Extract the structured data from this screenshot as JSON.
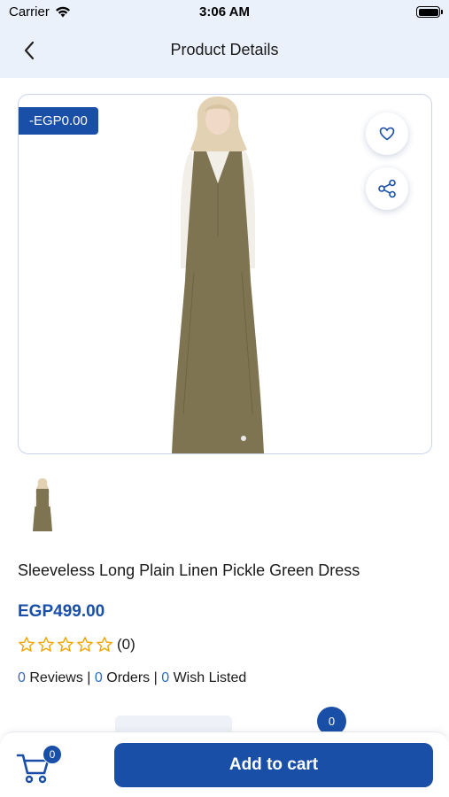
{
  "status_bar": {
    "carrier": "Carrier",
    "time": "3:06 AM"
  },
  "nav": {
    "title": "Product Details",
    "back_icon": "chevron-left-icon"
  },
  "product": {
    "discount_badge": "-EGP0.00",
    "name": "Sleeveless Long Plain Linen Pickle Green Dress",
    "price": "EGP499.00",
    "rating": 0,
    "rating_count": "(0)",
    "reviews_count": "0",
    "reviews_label": "Reviews",
    "orders_count": "0",
    "orders_label": "Orders",
    "wishlist_count": "0",
    "wishlist_label": "Wish Listed",
    "separator": "|"
  },
  "partial_badge_count": "0",
  "bottom_bar": {
    "cart_count": "0",
    "add_to_cart_label": "Add to cart"
  },
  "colors": {
    "primary": "#1a4fa8",
    "header_bg": "#eaf1fb",
    "star": "#f0a500",
    "count_blue": "#2a6cc8"
  }
}
